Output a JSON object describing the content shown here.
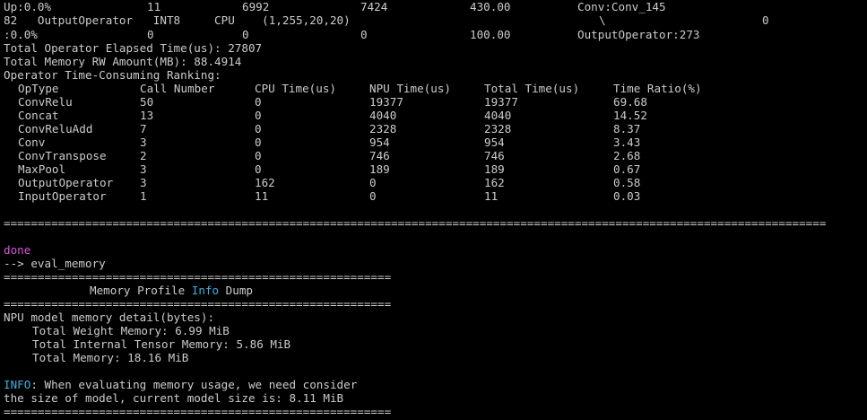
{
  "top_rows": [
    {
      "c0": "Up:0.0%",
      "c1": "11",
      "c2": "6992",
      "c3": "7424",
      "c4": "430.00",
      "c5": "Conv:Conv_145",
      "c6": ""
    },
    {
      "c0": "82   OutputOperator   INT8     CPU    (1,255,20,20)",
      "c1": "",
      "c2": "",
      "c3": "",
      "c4": "",
      "c5": "\\",
      "c6": "0"
    },
    {
      "c0": ":0.0%",
      "c1": "0",
      "c2": "0",
      "c3": "0",
      "c4": "100.00",
      "c5": "OutputOperator:273",
      "c6": ""
    }
  ],
  "summary": {
    "elapsed": "Total Operator Elapsed Time(us): 27807",
    "memory_rw": "Total Memory RW Amount(MB): 88.4914",
    "ranking_title": "Operator Time-Consuming Ranking:"
  },
  "ranking": {
    "headers": [
      "OpType",
      "Call Number",
      "CPU Time(us)",
      "NPU Time(us)",
      "Total Time(us)",
      "Time Ratio(%)"
    ],
    "rows": [
      [
        "ConvRelu",
        "50",
        "0",
        "19377",
        "19377",
        "69.68"
      ],
      [
        "Concat",
        "13",
        "0",
        "4040",
        "4040",
        "14.52"
      ],
      [
        "ConvReluAdd",
        "7",
        "0",
        "2328",
        "2328",
        "8.37"
      ],
      [
        "Conv",
        "3",
        "0",
        "954",
        "954",
        "3.43"
      ],
      [
        "ConvTranspose",
        "2",
        "0",
        "746",
        "746",
        "2.68"
      ],
      [
        "MaxPool",
        "3",
        "0",
        "189",
        "189",
        "0.67"
      ],
      [
        "OutputOperator",
        "3",
        "162",
        "0",
        "162",
        "0.58"
      ],
      [
        "InputOperator",
        "1",
        "11",
        "0",
        "11",
        "0.03"
      ]
    ]
  },
  "status": {
    "done": "done",
    "command": "--> eval_memory"
  },
  "memory_profile": {
    "title_prefix": "Memory Profile ",
    "title_info": "Info",
    "title_suffix": " Dump",
    "detail_heading": "NPU model memory detail(bytes):",
    "weight": "Total Weight Memory: 6.99 MiB",
    "internal": "Total Internal Tensor Memory: 5.86 MiB",
    "total": "Total Memory: 18.16 MiB"
  },
  "info_note": {
    "tag": "INFO",
    "line1_rest": ": When evaluating memory usage, we need consider",
    "line2": "the size of model, current model size is: 8.11 MiB"
  },
  "rules": {
    "long": "=========================================================================================================================",
    "short": "==========================================================="
  },
  "colors": {
    "background": "#000000",
    "text": "#cccccc",
    "done": "#d25ad2",
    "info": "#3fb0e0"
  }
}
